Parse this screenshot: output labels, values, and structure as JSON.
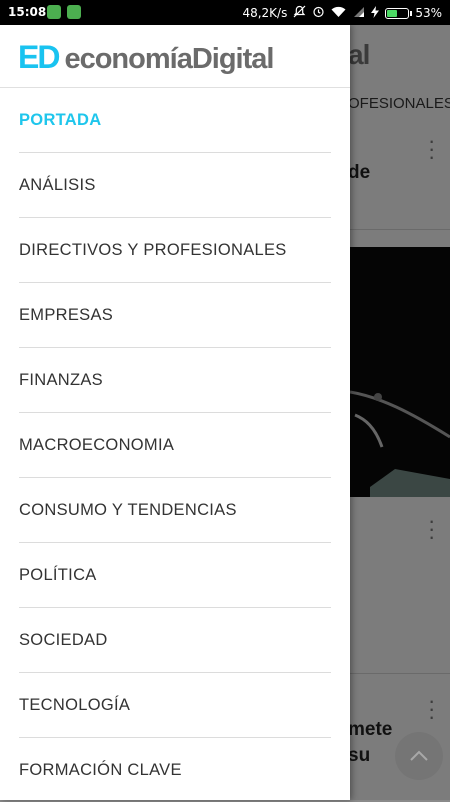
{
  "status_bar": {
    "time": "15:08",
    "network_speed": "48,2K/s",
    "battery_percent": "53%",
    "battery_level": 0.53
  },
  "background": {
    "logo_fragment": "al",
    "nav_fragment": "OFESIONALES",
    "headline1_fragment": "de",
    "headline2_line1": "mete",
    "headline2_line2": "su"
  },
  "drawer": {
    "logo": {
      "ed": "ED",
      "economia": "economía",
      "digital": "Digital"
    },
    "items": [
      {
        "label": "PORTADA",
        "active": true
      },
      {
        "label": "ANÁLISIS"
      },
      {
        "label": "DIRECTIVOS Y PROFESIONALES"
      },
      {
        "label": "EMPRESAS"
      },
      {
        "label": "FINANZAS"
      },
      {
        "label": "MACROECONOMIA"
      },
      {
        "label": "CONSUMO Y TENDENCIAS"
      },
      {
        "label": "POLÍTICA"
      },
      {
        "label": "SOCIEDAD"
      },
      {
        "label": "TECNOLOGÍA"
      },
      {
        "label": "FORMACIÓN CLAVE"
      }
    ]
  },
  "colors": {
    "accent": "#1fc6ec",
    "logo_gray": "#6b6b6b"
  }
}
